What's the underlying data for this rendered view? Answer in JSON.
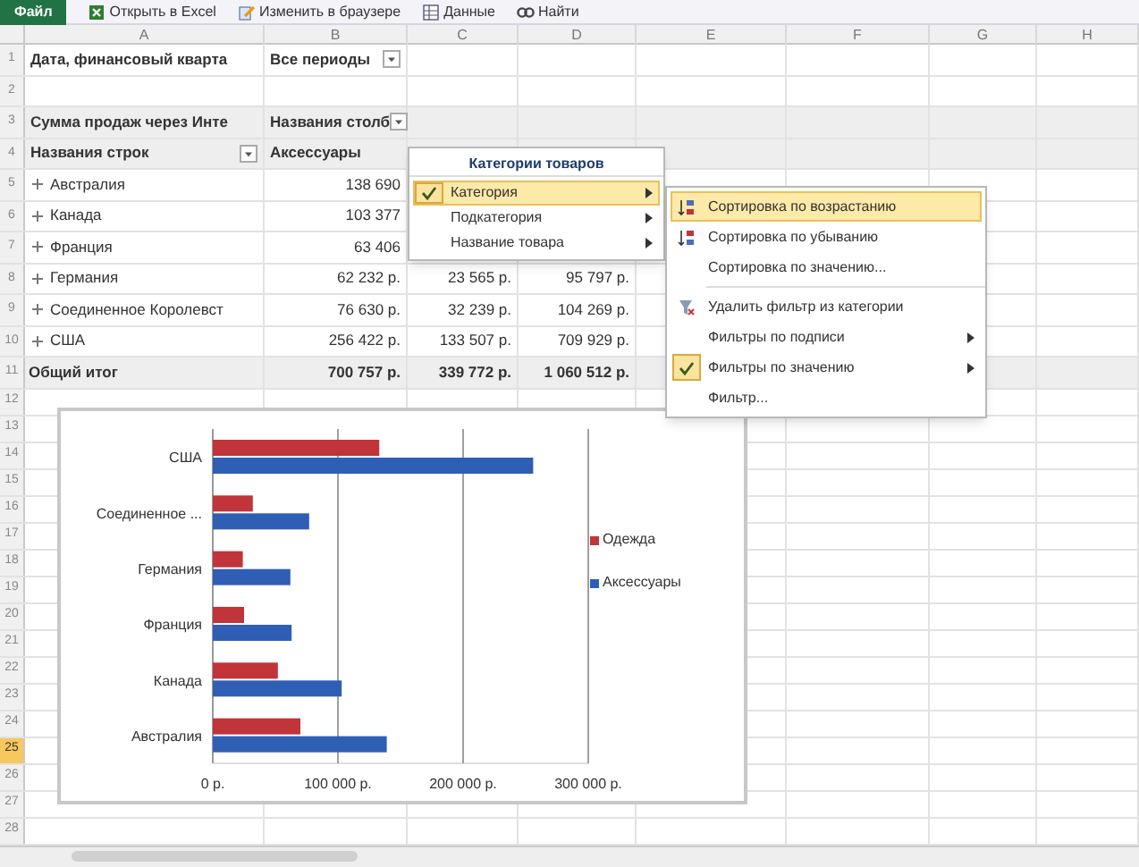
{
  "toolbar": {
    "buttons": [
      {
        "label": "Файл",
        "kind": "file"
      },
      {
        "label": "Открыть в Excel",
        "kind": "excel"
      },
      {
        "label": "Изменить в браузере",
        "kind": "edit"
      },
      {
        "label": "Данные",
        "kind": "data"
      },
      {
        "label": "Найти",
        "kind": "find"
      }
    ]
  },
  "sheet": {
    "columns": [
      "A",
      "B",
      "C",
      "D",
      "E",
      "F",
      "G",
      "H"
    ],
    "rows": [
      {
        "number": "1",
        "kind": "filter",
        "selected": false,
        "cells": [
          {
            "text": "Дата, финансовый кварта",
            "dropdown": false
          },
          {
            "text": "Все периоды",
            "dropdown": true
          }
        ]
      },
      {
        "number": "2",
        "kind": "empty",
        "selected": false
      },
      {
        "number": "3",
        "kind": "header",
        "selected": false,
        "cells": [
          {
            "text": "Сумма продаж через Инте",
            "dropdown": false
          },
          {
            "text": "Названия столб",
            "dropdown": true
          }
        ]
      },
      {
        "number": "4",
        "kind": "header",
        "selected": false,
        "cells": [
          {
            "text": "Названия строк",
            "dropdown": true
          },
          {
            "text": "Аксессуары",
            "dropdown": false
          }
        ]
      },
      {
        "number": "5",
        "kind": "item",
        "selected": false,
        "cells": [
          "Австралия",
          "138 690"
        ]
      },
      {
        "number": "6",
        "kind": "item",
        "selected": false,
        "cells": [
          "Канада",
          "103 377"
        ]
      },
      {
        "number": "7",
        "kind": "item",
        "selected": false,
        "cells": [
          "Франция",
          "63 406"
        ]
      },
      {
        "number": "8",
        "kind": "item",
        "selected": false,
        "cells": [
          "Германия",
          "62 232 р.",
          "23 565 р.",
          "95 797 р."
        ]
      },
      {
        "number": "9",
        "kind": "item",
        "selected": false,
        "cells": [
          "Соединенное Королевст",
          "76 630 р.",
          "32 239 р.",
          "104 269 р."
        ]
      },
      {
        "number": "10",
        "kind": "item",
        "selected": false,
        "cells": [
          "США",
          "256 422 р.",
          "133 507 р.",
          "709 929 р."
        ]
      },
      {
        "number": "11",
        "kind": "total",
        "selected": false,
        "cells": [
          "Общий итог",
          "700 757 р.",
          "339 772 р.",
          "1 060 512 р."
        ]
      },
      {
        "number": "12",
        "kind": "empty",
        "selected": false
      },
      {
        "number": "13",
        "kind": "empty",
        "selected": false
      },
      {
        "number": "14",
        "kind": "empty",
        "selected": false
      },
      {
        "number": "15",
        "kind": "empty",
        "selected": false
      },
      {
        "number": "16",
        "kind": "empty",
        "selected": false
      },
      {
        "number": "17",
        "kind": "empty",
        "selected": false
      },
      {
        "number": "18",
        "kind": "empty",
        "selected": false
      },
      {
        "number": "19",
        "kind": "empty",
        "selected": false
      },
      {
        "number": "20",
        "kind": "empty",
        "selected": false
      },
      {
        "number": "21",
        "kind": "empty",
        "selected": false
      },
      {
        "number": "22",
        "kind": "empty",
        "selected": false
      },
      {
        "number": "23",
        "kind": "empty",
        "selected": false
      },
      {
        "number": "24",
        "kind": "empty",
        "selected": false
      },
      {
        "number": "25",
        "kind": "empty",
        "selected": true
      },
      {
        "number": "26",
        "kind": "empty",
        "selected": false
      },
      {
        "number": "27",
        "kind": "empty",
        "selected": false
      },
      {
        "number": "28",
        "kind": "empty",
        "selected": false
      }
    ]
  },
  "chart": {
    "chart_data": {
      "type": "bar",
      "orientation": "horizontal",
      "categories": [
        "США",
        "Соединенное ...",
        "Германия",
        "Франция",
        "Канада",
        "Австралия"
      ],
      "series": [
        {
          "name": "Одежда",
          "color": "#c0343a",
          "values": [
            133000,
            32000,
            24000,
            25000,
            52000,
            70000
          ]
        },
        {
          "name": "Аксессуары",
          "color": "#2f5fb5",
          "values": [
            256000,
            77000,
            62000,
            63000,
            103000,
            139000
          ]
        }
      ],
      "legend": "right",
      "xlim": [
        0,
        300000
      ],
      "xticks": [
        {
          "value": 0,
          "label": "0 р."
        },
        {
          "value": 100000,
          "label": "100 000 р."
        },
        {
          "value": 200000,
          "label": "200 000 р."
        },
        {
          "value": 300000,
          "label": "300 000 р."
        }
      ]
    }
  },
  "field_menu": {
    "title": "Категории товаров",
    "items": [
      {
        "label": "Категория",
        "checked": true,
        "highlighted": true,
        "submenu": true
      },
      {
        "label": "Подкатегория",
        "checked": false,
        "highlighted": false,
        "submenu": true
      },
      {
        "label": "Название товара",
        "checked": false,
        "highlighted": false,
        "submenu": true
      }
    ]
  },
  "submenu": {
    "items": [
      {
        "kind": "sort-asc",
        "label": "Сортировка по возрастанию",
        "checked": false,
        "highlighted": true,
        "submenu": false
      },
      {
        "kind": "sort-desc",
        "label": "Сортировка по убыванию",
        "checked": false,
        "highlighted": false,
        "submenu": false
      },
      {
        "kind": "plain",
        "label": "Сортировка по значению...",
        "checked": false,
        "highlighted": false,
        "submenu": false
      },
      {
        "kind": "separator"
      },
      {
        "kind": "clear-filter",
        "label": "Удалить фильтр из категории",
        "checked": false,
        "highlighted": false,
        "submenu": false
      },
      {
        "kind": "plain",
        "label": "Фильтры по подписи",
        "checked": false,
        "highlighted": false,
        "submenu": true
      },
      {
        "kind": "plain",
        "label": "Фильтры по значению",
        "checked": true,
        "highlighted": false,
        "submenu": true
      },
      {
        "kind": "plain",
        "label": "Фильтр...",
        "checked": false,
        "highlighted": false,
        "submenu": false
      }
    ]
  }
}
